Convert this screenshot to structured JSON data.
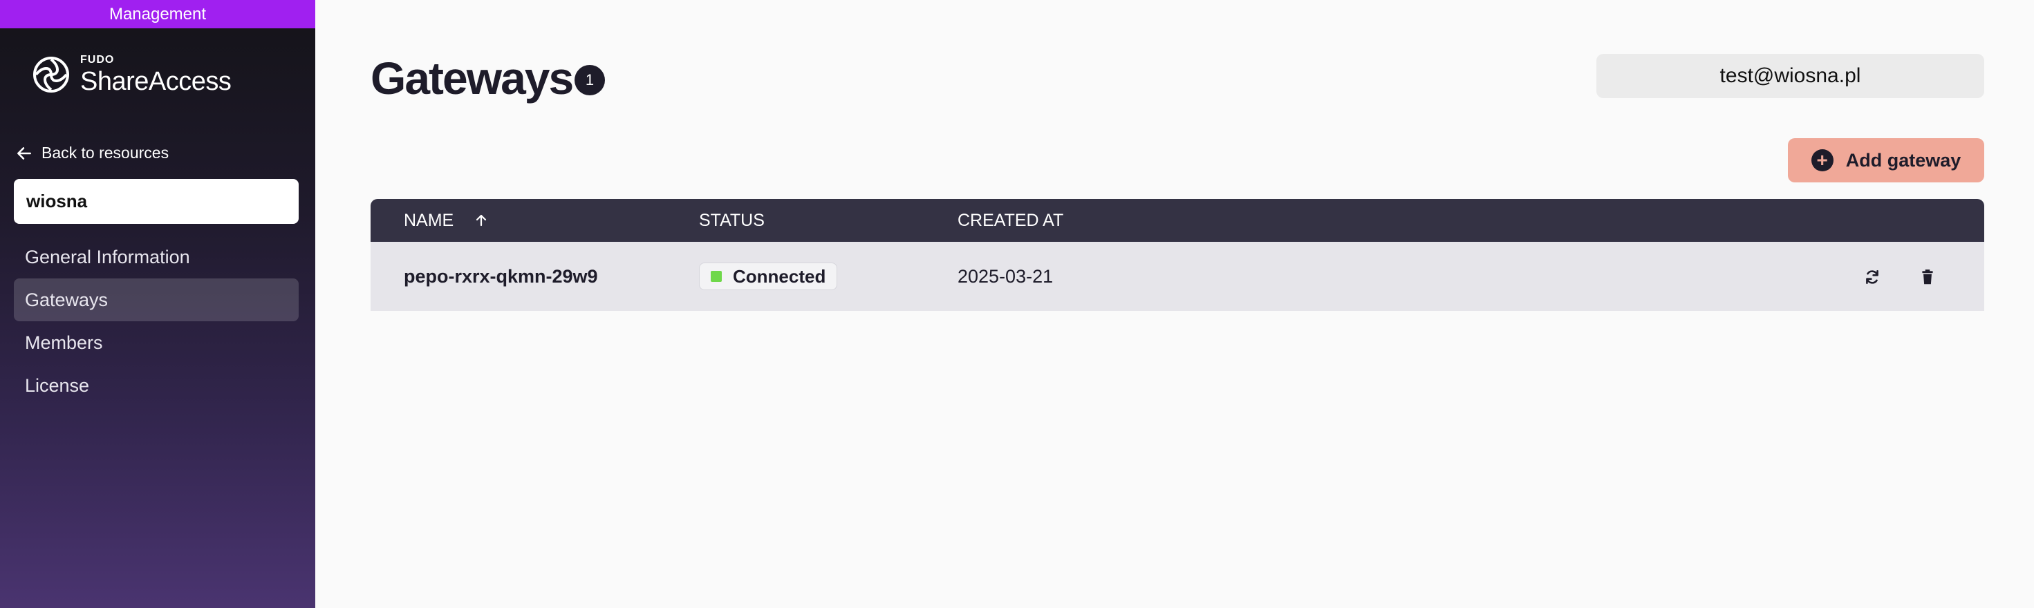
{
  "sidebar": {
    "management_label": "Management",
    "logo_small": "FUDO",
    "logo_big": "ShareAccess",
    "back_label": "Back to resources",
    "resource_name": "wiosna",
    "items": [
      {
        "label": "General Information",
        "active": false
      },
      {
        "label": "Gateways",
        "active": true
      },
      {
        "label": "Members",
        "active": false
      },
      {
        "label": "License",
        "active": false
      }
    ]
  },
  "header": {
    "title": "Gateways",
    "count": "1",
    "user_email": "test@wiosna.pl"
  },
  "actions": {
    "add_label": "Add gateway"
  },
  "table": {
    "columns": [
      "NAME",
      "STATUS",
      "CREATED AT"
    ],
    "sort": {
      "column": "NAME",
      "direction": "ascending"
    },
    "rows": [
      {
        "name": "pepo-rxrx-qkmn-29w9",
        "status": "Connected",
        "created_at": "2025-03-21"
      }
    ]
  },
  "colors": {
    "brand_purple": "#a020f0",
    "accent_button": "#f0a898",
    "status_connected": "#6fd84a",
    "table_header": "#343244"
  },
  "icons": [
    "arrow-left-icon",
    "sort-up-icon",
    "plus-circle-icon",
    "refresh-icon",
    "trash-icon",
    "fudo-logo-icon"
  ]
}
